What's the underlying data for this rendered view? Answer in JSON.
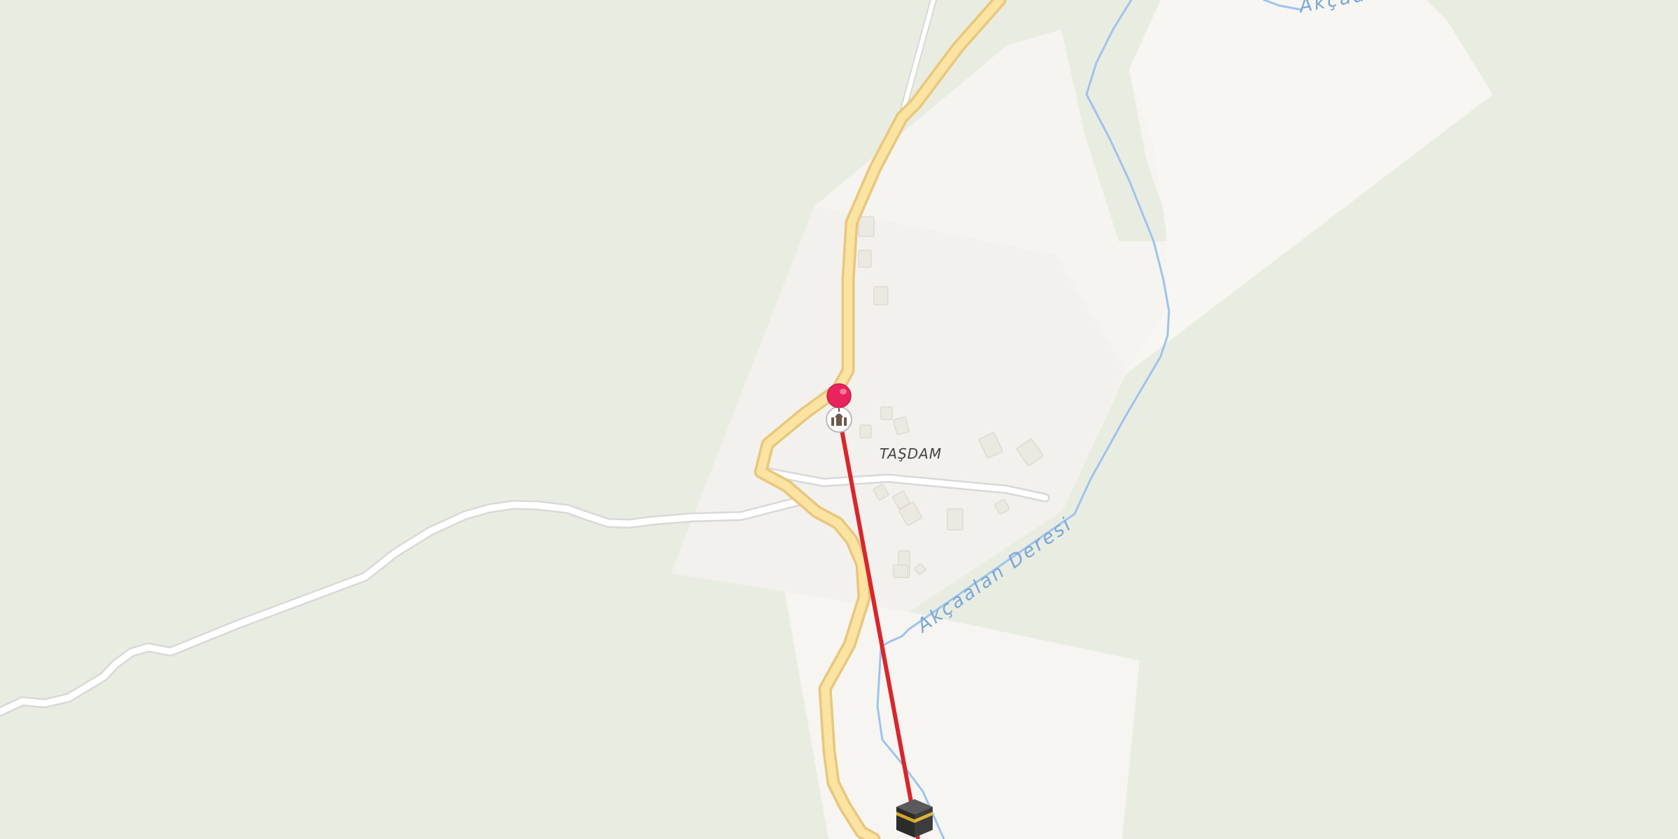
{
  "map": {
    "place_label": "TAŞDAM",
    "water_labels": [
      "Akçaalan Deresi",
      "Akçaa"
    ],
    "markers": [
      {
        "name": "location-pin",
        "icon": "map-pin-icon",
        "color": "#e8245e"
      },
      {
        "name": "mosque",
        "icon": "mosque-icon"
      },
      {
        "name": "kaaba",
        "icon": "kaaba-icon"
      }
    ],
    "route": {
      "color": "#d9262b",
      "meaning": "qibla direction line"
    },
    "colors": {
      "background": "#e9ede1",
      "settlement": "#f4f3ef",
      "road_fill": "#fbe3a1",
      "road_casing": "#e8c77c",
      "minor_road": "#ffffff",
      "water": "#9ec3ec"
    }
  }
}
